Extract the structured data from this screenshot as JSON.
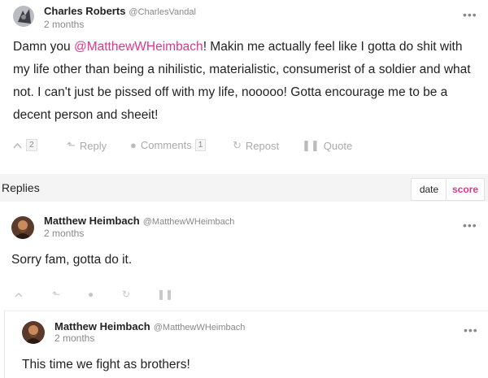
{
  "post": {
    "author": "Charles Roberts",
    "handle": "@CharlesVandal",
    "time": "2 months",
    "text_before": "Damn you ",
    "mention": "@MatthewWHeimbach",
    "text_after": "! Makin me actually feel like I gotta do shit with my life other than being a nihilistic, materialistic, consumerist of a soldier and what not. I can't just be pissed off with my life, nooooo! Gotta encourage me to be a decent person and sheeit!",
    "actions": {
      "upvote_count": "2",
      "reply_label": "Reply",
      "comments_label": "Comments",
      "comments_count": "1",
      "repost_label": "Repost",
      "quote_label": "Quote"
    }
  },
  "replies": {
    "title": "Replies",
    "sort_date": "date",
    "sort_score": "score",
    "items": [
      {
        "author": "Matthew Heimbach",
        "handle": "@MatthewWHeimbach",
        "time": "2 months",
        "text": "Sorry fam, gotta do it."
      },
      {
        "author": "Matthew Heimbach",
        "handle": "@MatthewWHeimbach",
        "time": "2 months",
        "text": "This time we fight as brothers!"
      }
    ]
  },
  "icons": {
    "more": "more-dots-icon",
    "upvote": "chevron-up-icon",
    "reply": "reply-arrow-icon",
    "comments": "comment-bubble-icon",
    "repost": "repost-icon",
    "quote": "quote-icon"
  },
  "colors": {
    "accent": "#e0368a",
    "muted": "#888888",
    "bar_bg": "#f4f4f4"
  }
}
